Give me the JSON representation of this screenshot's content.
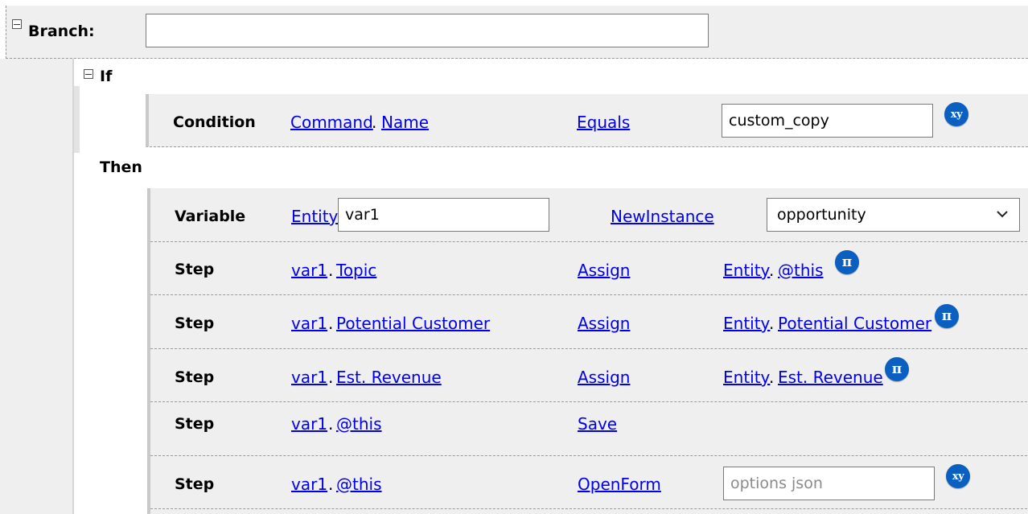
{
  "branch": {
    "label": "Branch:",
    "input_value": ""
  },
  "if_block": {
    "label": "If"
  },
  "condition": {
    "label": "Condition",
    "left": [
      "Command",
      "Name"
    ],
    "operator": "Equals",
    "value": "custom_copy",
    "badge_icon": "xy-variable-icon",
    "badge_text": "xy"
  },
  "then_block": {
    "label": "Then",
    "variable": {
      "label": "Variable",
      "type_link": "Entity",
      "name_value": "var1",
      "action": "NewInstance",
      "entity_selected": "opportunity"
    },
    "steps": [
      {
        "label": "Step",
        "target": [
          "var1",
          "Topic"
        ],
        "action": "Assign",
        "source": [
          "Entity",
          "@this"
        ],
        "badge_icon": "pi-formula-icon",
        "badge_text": "π"
      },
      {
        "label": "Step",
        "target": [
          "var1",
          "Potential Customer"
        ],
        "action": "Assign",
        "source": [
          "Entity",
          "Potential Customer"
        ],
        "badge_icon": "pi-formula-icon",
        "badge_text": "π"
      },
      {
        "label": "Step",
        "target": [
          "var1",
          "Est. Revenue"
        ],
        "action": "Assign",
        "source": [
          "Entity",
          "Est. Revenue"
        ],
        "badge_icon": "pi-formula-icon",
        "badge_text": "π"
      },
      {
        "label": "Step",
        "target": [
          "var1",
          "@this"
        ],
        "action": "Save"
      },
      {
        "label": "Step",
        "target": [
          "var1",
          "@this"
        ],
        "action": "OpenForm",
        "options_placeholder": "options json",
        "badge_icon": "xy-variable-icon",
        "badge_text": "xy"
      }
    ]
  },
  "colors": {
    "link": "#0000ee",
    "badge": "#0a5fc1",
    "band": "#efefef"
  }
}
